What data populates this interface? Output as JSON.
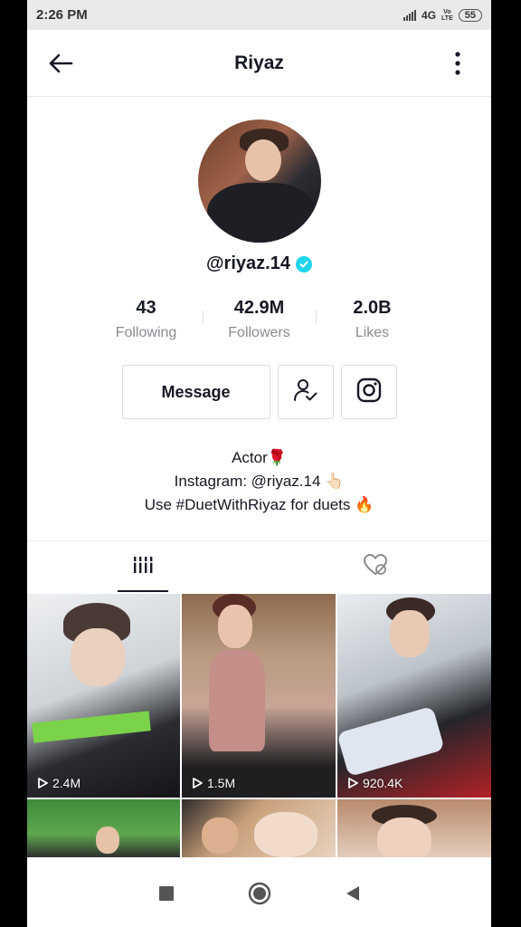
{
  "status_bar": {
    "time": "2:26 PM",
    "network": "4G",
    "volte": "Vo",
    "lte": "LTE",
    "battery": "55"
  },
  "header": {
    "title": "Riyaz"
  },
  "profile": {
    "username": "@riyaz.14",
    "stats": [
      {
        "value": "43",
        "label": "Following"
      },
      {
        "value": "42.9M",
        "label": "Followers"
      },
      {
        "value": "2.0B",
        "label": "Likes"
      }
    ],
    "message_label": "Message",
    "bio": [
      "Actor🌹",
      "Instagram: @riyaz.14 👆🏻",
      "Use #DuetWithRiyaz for duets 🔥"
    ]
  },
  "videos": [
    {
      "views": "2.4M"
    },
    {
      "views": "1.5M"
    },
    {
      "views": "920.4K"
    }
  ],
  "colors": {
    "verified": "#20d5ec",
    "text": "#161823",
    "muted": "#8a8b91"
  }
}
